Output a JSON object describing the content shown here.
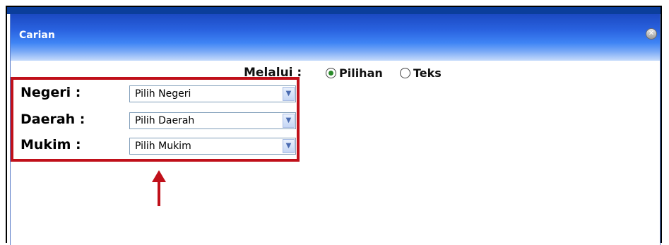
{
  "dialog": {
    "title": "Carian",
    "close_icon": "close-icon"
  },
  "mode": {
    "label": "Melalui :",
    "options": [
      {
        "label": "Pilihan",
        "selected": true
      },
      {
        "label": "Teks",
        "selected": false
      }
    ]
  },
  "fields": [
    {
      "label": "Negeri :",
      "value": "Pilih Negeri"
    },
    {
      "label": "Daerah :",
      "value": "Pilih Daerah"
    },
    {
      "label": "Mukim :",
      "value": "Pilih Mukim"
    }
  ],
  "colors": {
    "title_bar": "#2a63e0",
    "annotation": "#c0101a",
    "radio_checked": "#2a8a2a"
  }
}
